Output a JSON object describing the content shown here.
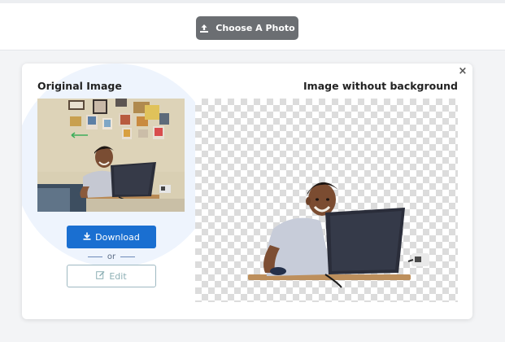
{
  "toolbar": {
    "choose_label": "Choose A Photo",
    "upload_icon": "upload-icon"
  },
  "card": {
    "close_icon": "close-icon",
    "original_title": "Original Image",
    "result_title": "Image without background",
    "download_label": "Download",
    "download_icon": "download-icon",
    "or_label": "or",
    "edit_label": "Edit",
    "edit_icon": "edit-icon"
  },
  "colors": {
    "accent_blue": "#1a6fd1",
    "choose_button_bg": "#6b6e72",
    "edit_border": "#9fb9c2",
    "halo": "#eef4fd"
  }
}
